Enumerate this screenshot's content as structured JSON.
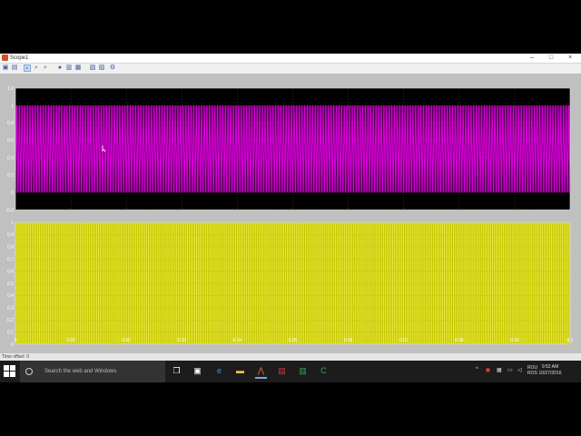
{
  "window": {
    "title": "Scope1",
    "minimize_glyph": "–",
    "maximize_glyph": "□",
    "close_glyph": "×"
  },
  "toolbar": {
    "icons": [
      "print-icon",
      "parameters-icon",
      "zoom-icon",
      "zoom-x-icon",
      "zoom-y-icon",
      "autoscale-icon",
      "save-axes-icon",
      "restore-axes-icon",
      "float-icon",
      "lock-axes-icon",
      "signal-selection-icon"
    ]
  },
  "colors": {
    "signal1": "#e600e6",
    "signal2": "#f0f000",
    "axes_bg": "#000000",
    "figure_bg": "#c0c0c0"
  },
  "chart_data": [
    {
      "type": "line",
      "series": [
        {
          "values_description_range": [
            0,
            1
          ]
        }
      ],
      "ylim": [
        -0.2,
        1.2
      ],
      "yticks": [
        "1.2",
        "1",
        "0.8",
        "0.6",
        "0.4",
        "0.2",
        "0",
        "-0.2"
      ],
      "xlim": [
        0,
        0.1
      ],
      "xticks": [],
      "grid": true
    },
    {
      "type": "line",
      "ylim": [
        0,
        1
      ],
      "yticks": [
        "1",
        "0.9",
        "0.8",
        "0.7",
        "0.6",
        "0.5",
        "0.4",
        "0.3",
        "0.2",
        "0.1",
        "0"
      ],
      "xlim": [
        0,
        0.1
      ],
      "xticks": [
        "0",
        "0.01",
        "0.02",
        "0.03",
        "0.04",
        "0.05",
        "0.06",
        "0.07",
        "0.08",
        "0.09",
        "0.1"
      ],
      "grid": true
    }
  ],
  "statusbar": {
    "text": "Time offset: 0"
  },
  "taskbar": {
    "search_placeholder": "Search the web and Windows",
    "lang": "ROU",
    "lang2": "ROS",
    "time": "9:52 AM",
    "date": "10/27/2016"
  }
}
